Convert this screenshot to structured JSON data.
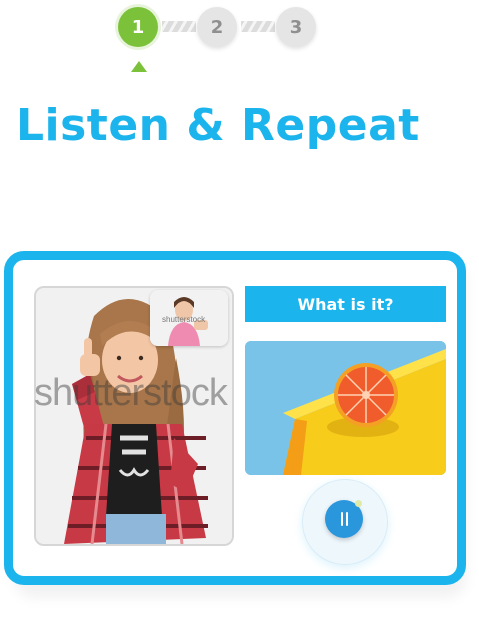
{
  "stepper": {
    "steps": [
      {
        "label": "1",
        "state": "active"
      },
      {
        "label": "2",
        "state": "inactive"
      },
      {
        "label": "3",
        "state": "inactive"
      }
    ]
  },
  "title": "Listen & Repeat",
  "video": {
    "main_alt": "child-giving-thumbs-up",
    "watermark": "shutterstock",
    "pip_label": "shutterstock"
  },
  "question": {
    "text": "What is it?",
    "image_alt": "grapefruit-half-on-yellow-and-blue-background"
  },
  "controls": {
    "play_icon": "pause-icon"
  },
  "colors": {
    "accent": "#1cb4ec",
    "step_active": "#7cc13a",
    "step_inactive": "#e5e5e5",
    "play_button": "#2a97dd"
  }
}
